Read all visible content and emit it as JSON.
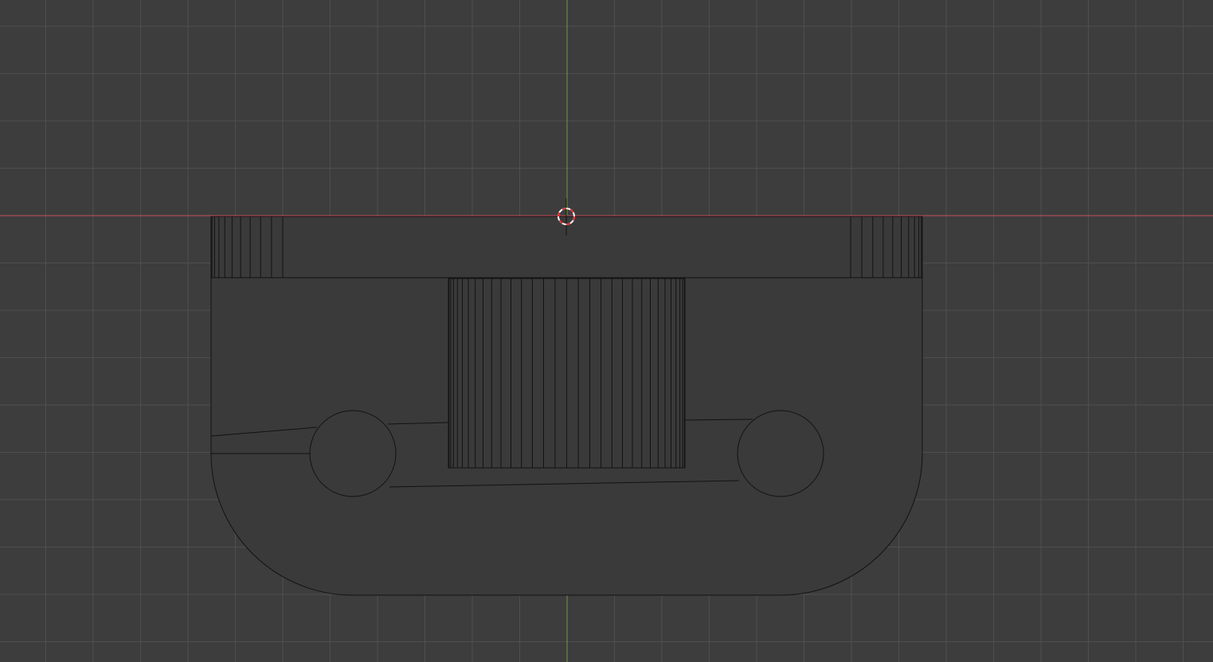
{
  "viewport": {
    "view": "orthographic-front",
    "shading": "solid",
    "colors": {
      "background": "#3d3d3d",
      "grid_line": "#4e4e4e",
      "x_axis": "#c8505a",
      "z_axis": "#6a9a3a",
      "object_fill": "#3a3a3a",
      "edge": "#121212",
      "cursor_red": "#e23030",
      "cursor_white": "#ffffff"
    },
    "icons": {
      "cursor": "3d-cursor-icon"
    }
  }
}
